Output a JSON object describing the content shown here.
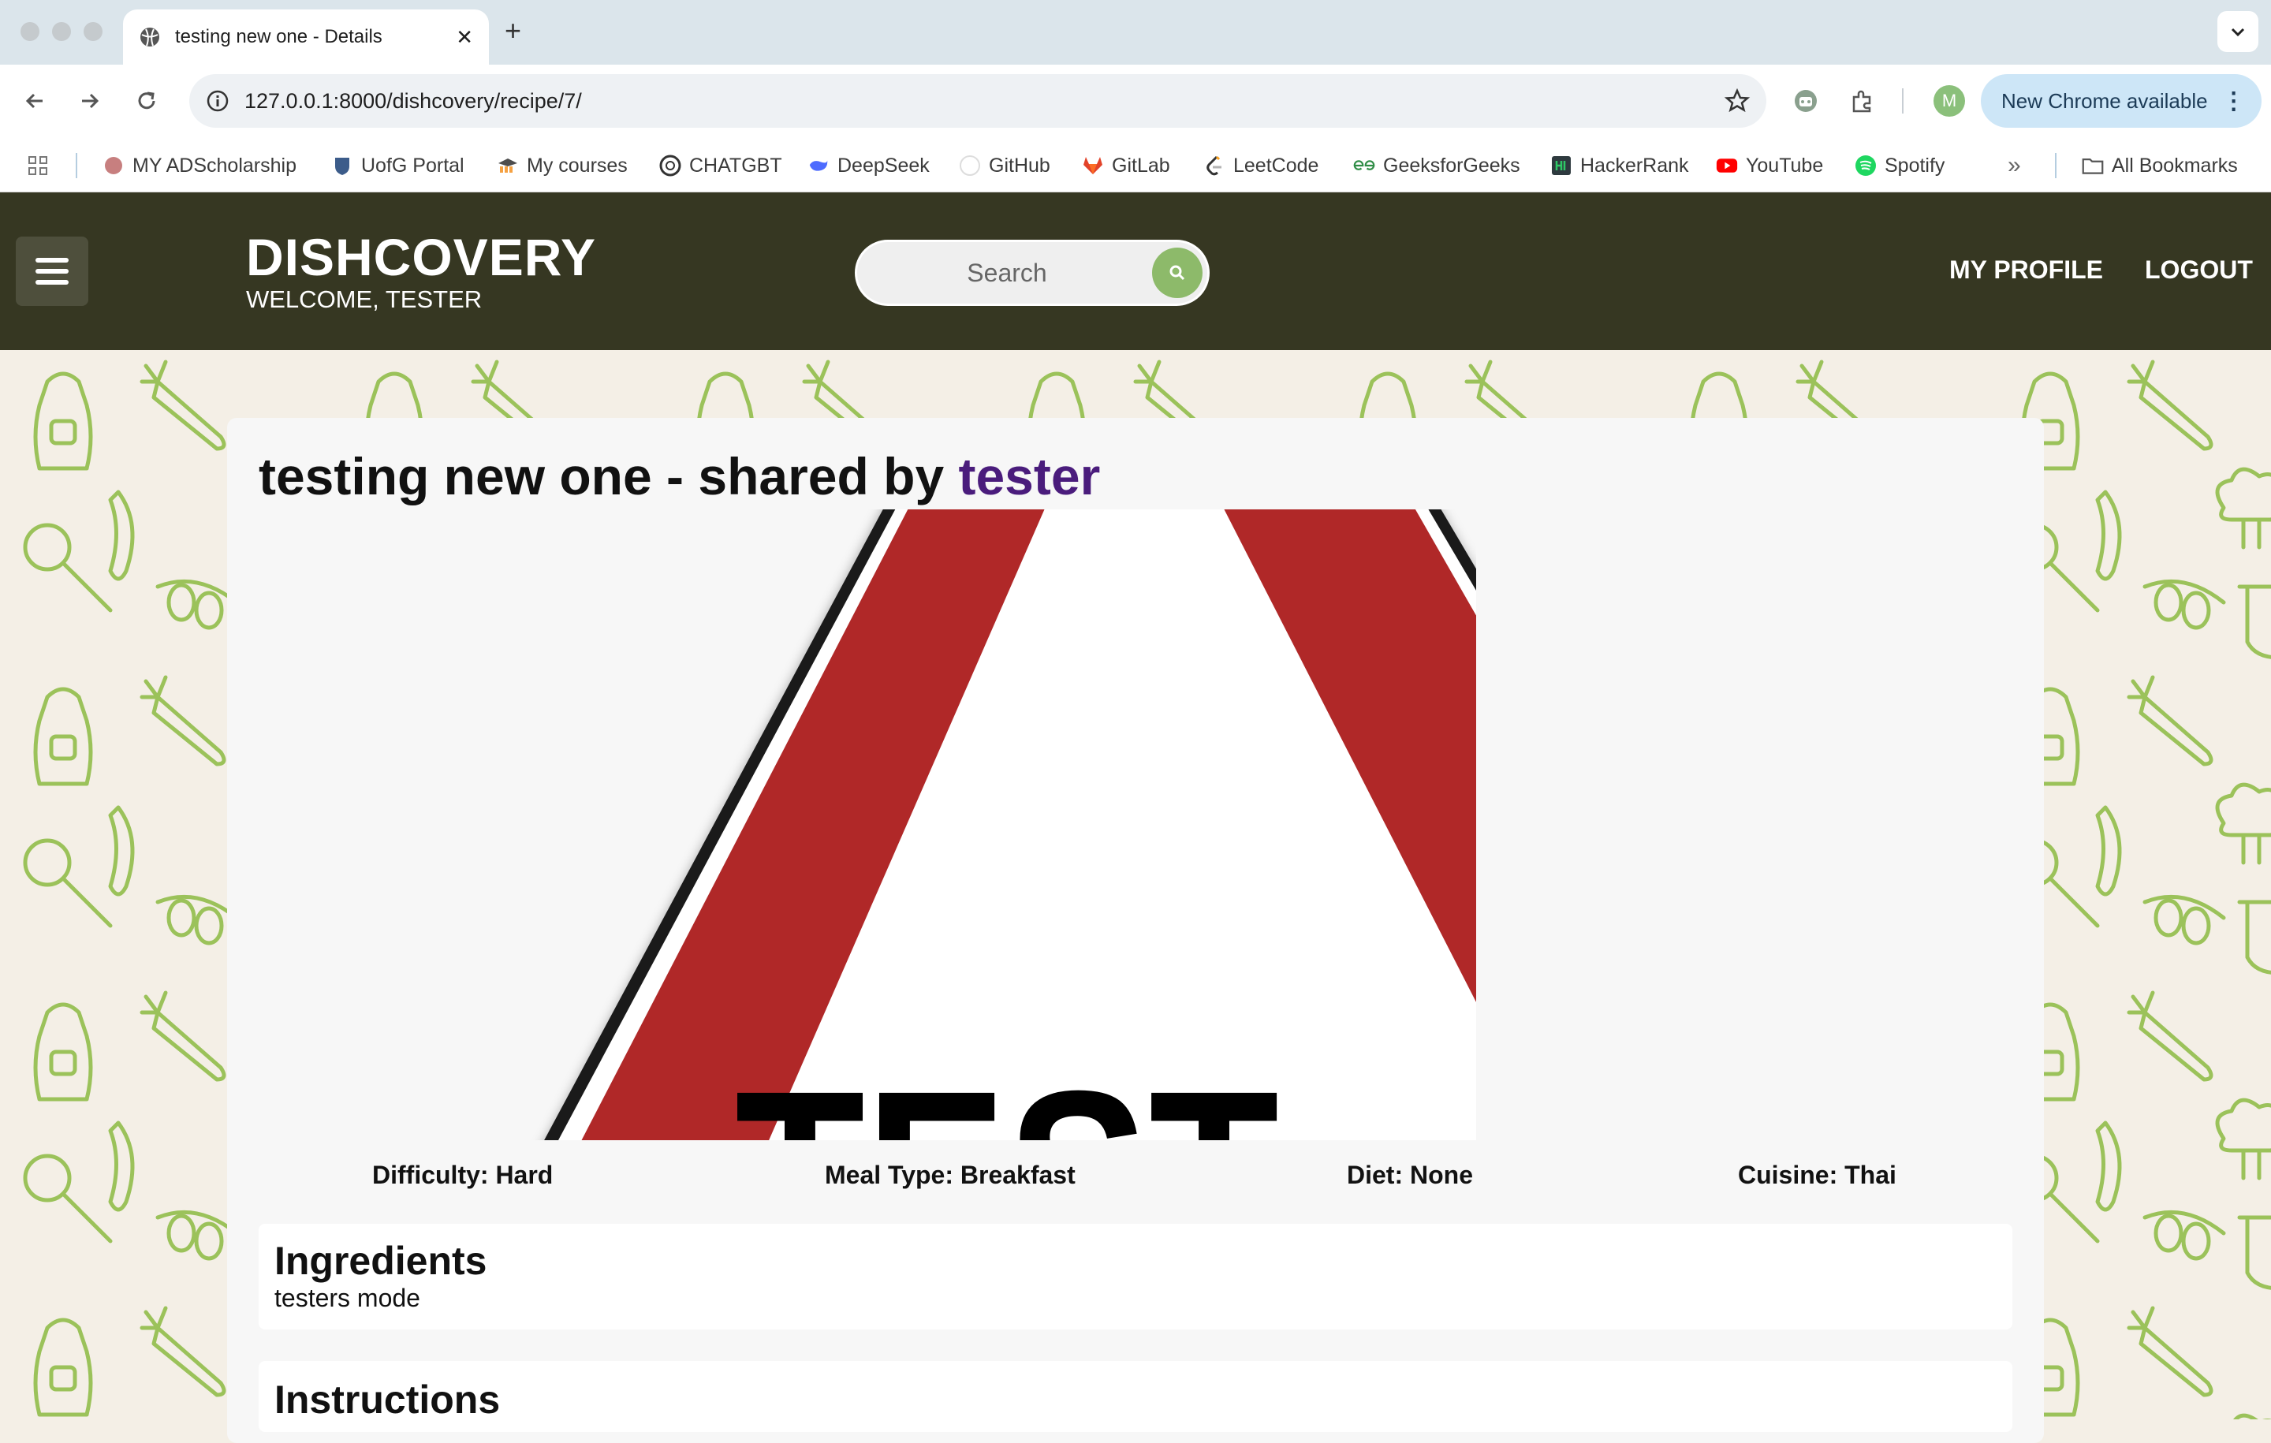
{
  "browser": {
    "tab_title": "testing new one - Details",
    "url": "127.0.0.1:8000/dishcovery/recipe/7/",
    "new_chrome_label": "New Chrome available",
    "profile_initial": "M",
    "bookmarks": [
      {
        "label": "MY ADScholarship",
        "icon": "scholarship-icon"
      },
      {
        "label": "UofG Portal",
        "icon": "uofg-crest-icon"
      },
      {
        "label": "My courses",
        "icon": "moodle-icon"
      },
      {
        "label": "CHATGBT",
        "icon": "openai-icon"
      },
      {
        "label": "DeepSeek",
        "icon": "deepseek-whale-icon"
      },
      {
        "label": "GitHub",
        "icon": "github-icon"
      },
      {
        "label": "GitLab",
        "icon": "gitlab-icon"
      },
      {
        "label": "LeetCode",
        "icon": "leetcode-icon"
      },
      {
        "label": "GeeksforGeeks",
        "icon": "geeksforgeeks-icon"
      },
      {
        "label": "HackerRank",
        "icon": "hackerrank-icon"
      },
      {
        "label": "YouTube",
        "icon": "youtube-icon"
      },
      {
        "label": "Spotify",
        "icon": "spotify-icon"
      }
    ],
    "all_bookmarks_label": "All Bookmarks"
  },
  "header": {
    "brand": "DISHCOVERY",
    "welcome": "WELCOME, TESTER",
    "search_placeholder": "Search",
    "nav": [
      "MY PROFILE",
      "LOGOUT"
    ]
  },
  "recipe": {
    "title": "testing new one - shared by",
    "author": "tester",
    "image_text": "TEST",
    "meta": {
      "difficulty": "Difficulty: Hard",
      "meal_type": "Meal Type: Breakfast",
      "diet": "Diet: None",
      "cuisine": "Cuisine: Thai"
    },
    "ingredients_heading": "Ingredients",
    "ingredients_text": "testers mode",
    "instructions_heading": "Instructions"
  },
  "colors": {
    "header_bg": "#363722",
    "accent_green": "#8dba6a",
    "author_purple": "#4a1c7c",
    "sign_red": "#b02828"
  }
}
